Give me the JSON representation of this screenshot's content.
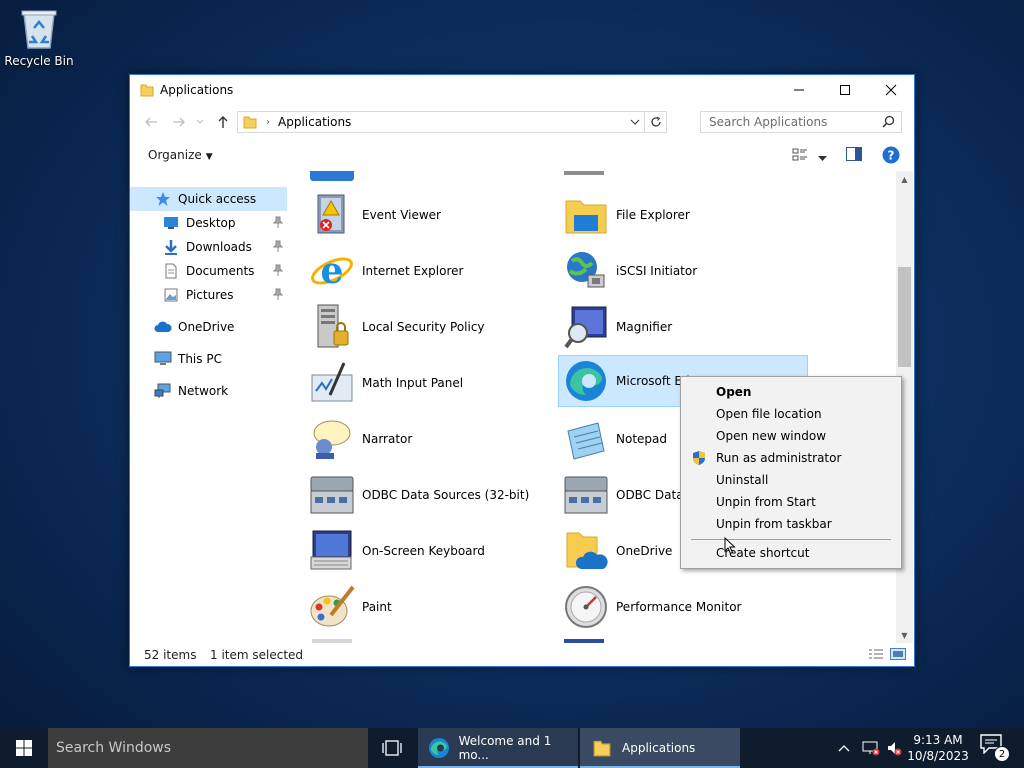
{
  "desktop": {
    "recycle_bin_label": "Recycle Bin"
  },
  "window": {
    "title": "Applications",
    "address_crumb": "Applications",
    "search_placeholder": "Search Applications",
    "organize_label": "Organize",
    "accent": "#2b79d0"
  },
  "navpane": {
    "items": [
      {
        "label": "Quick access",
        "icon": "star-icon"
      },
      {
        "label": "Desktop",
        "icon": "desktop-folder-icon"
      },
      {
        "label": "Downloads",
        "icon": "download-icon"
      },
      {
        "label": "Documents",
        "icon": "document-icon"
      },
      {
        "label": "Pictures",
        "icon": "pictures-icon"
      },
      {
        "label": "OneDrive",
        "icon": "cloud-icon"
      },
      {
        "label": "This PC",
        "icon": "computer-icon"
      },
      {
        "label": "Network",
        "icon": "network-icon"
      }
    ]
  },
  "apps": [
    {
      "label": "Event Viewer",
      "icon": "event-viewer-icon"
    },
    {
      "label": "File Explorer",
      "icon": "file-explorer-icon"
    },
    {
      "label": "Internet Explorer",
      "icon": "internet-explorer-icon"
    },
    {
      "label": "iSCSI Initiator",
      "icon": "iscsi-initiator-icon"
    },
    {
      "label": "Local Security Policy",
      "icon": "security-policy-icon"
    },
    {
      "label": "Magnifier",
      "icon": "magnifier-icon"
    },
    {
      "label": "Math Input Panel",
      "icon": "math-input-icon"
    },
    {
      "label": "Microsoft Ed",
      "icon": "edge-icon"
    },
    {
      "label": "Narrator",
      "icon": "narrator-icon"
    },
    {
      "label": "Notepad",
      "icon": "notepad-icon"
    },
    {
      "label": "ODBC Data Sources (32-bit)",
      "icon": "odbc-icon"
    },
    {
      "label": "ODBC Data S",
      "icon": "odbc-icon"
    },
    {
      "label": "On-Screen Keyboard",
      "icon": "keyboard-icon"
    },
    {
      "label": "OneDrive",
      "icon": "onedrive-folder-icon"
    },
    {
      "label": "Paint",
      "icon": "paint-icon"
    },
    {
      "label": "Performance Monitor",
      "icon": "performance-monitor-icon"
    }
  ],
  "status": {
    "item_count": "52 items",
    "selection": "1 item selected"
  },
  "context_menu": {
    "items": [
      {
        "label": "Open",
        "bold": true
      },
      {
        "label": "Open file location"
      },
      {
        "label": "Open new window"
      },
      {
        "label": "Run as administrator",
        "icon": "uac-shield-icon"
      },
      {
        "label": "Uninstall"
      },
      {
        "label": "Unpin from Start"
      },
      {
        "label": "Unpin from taskbar"
      },
      {
        "label": "Create shortcut"
      }
    ]
  },
  "taskbar": {
    "search_placeholder": "Search Windows",
    "edge_window_label": "Welcome and 1 mo...",
    "explorer_window_label": "Applications",
    "time": "9:13 AM",
    "date": "10/8/2023",
    "notification_count": "2",
    "background": "#0f1c2e"
  }
}
